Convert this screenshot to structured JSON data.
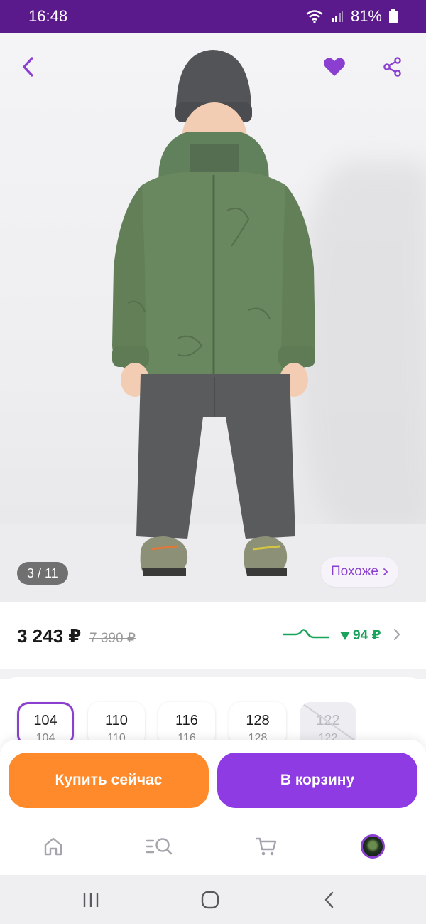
{
  "status_bar": {
    "time": "16:48",
    "battery": "81%"
  },
  "gallery": {
    "counter": "3 / 11",
    "similar_label": "Похоже"
  },
  "price": {
    "current": "3 243 ₽",
    "old": "7 390 ₽",
    "drop": "94 ₽",
    "drop_color": "#1aa35a"
  },
  "sizes": [
    {
      "main": "104",
      "sub": "104",
      "selected": true,
      "available": true
    },
    {
      "main": "110",
      "sub": "110",
      "selected": false,
      "available": true
    },
    {
      "main": "116",
      "sub": "116",
      "selected": false,
      "available": true
    },
    {
      "main": "128",
      "sub": "128",
      "selected": false,
      "available": true
    },
    {
      "main": "122",
      "sub": "122",
      "selected": false,
      "available": false
    }
  ],
  "actions": {
    "buy_now": "Купить сейчас",
    "add_to_cart": "В корзину"
  },
  "tabs": [
    {
      "icon": "home-icon"
    },
    {
      "icon": "catalog-search-icon"
    },
    {
      "icon": "cart-icon"
    },
    {
      "icon": "profile-avatar"
    }
  ],
  "colors": {
    "brand": "#8f3be4",
    "status_bar": "#5b1a8c",
    "buy_button": "#ff8a2b"
  }
}
